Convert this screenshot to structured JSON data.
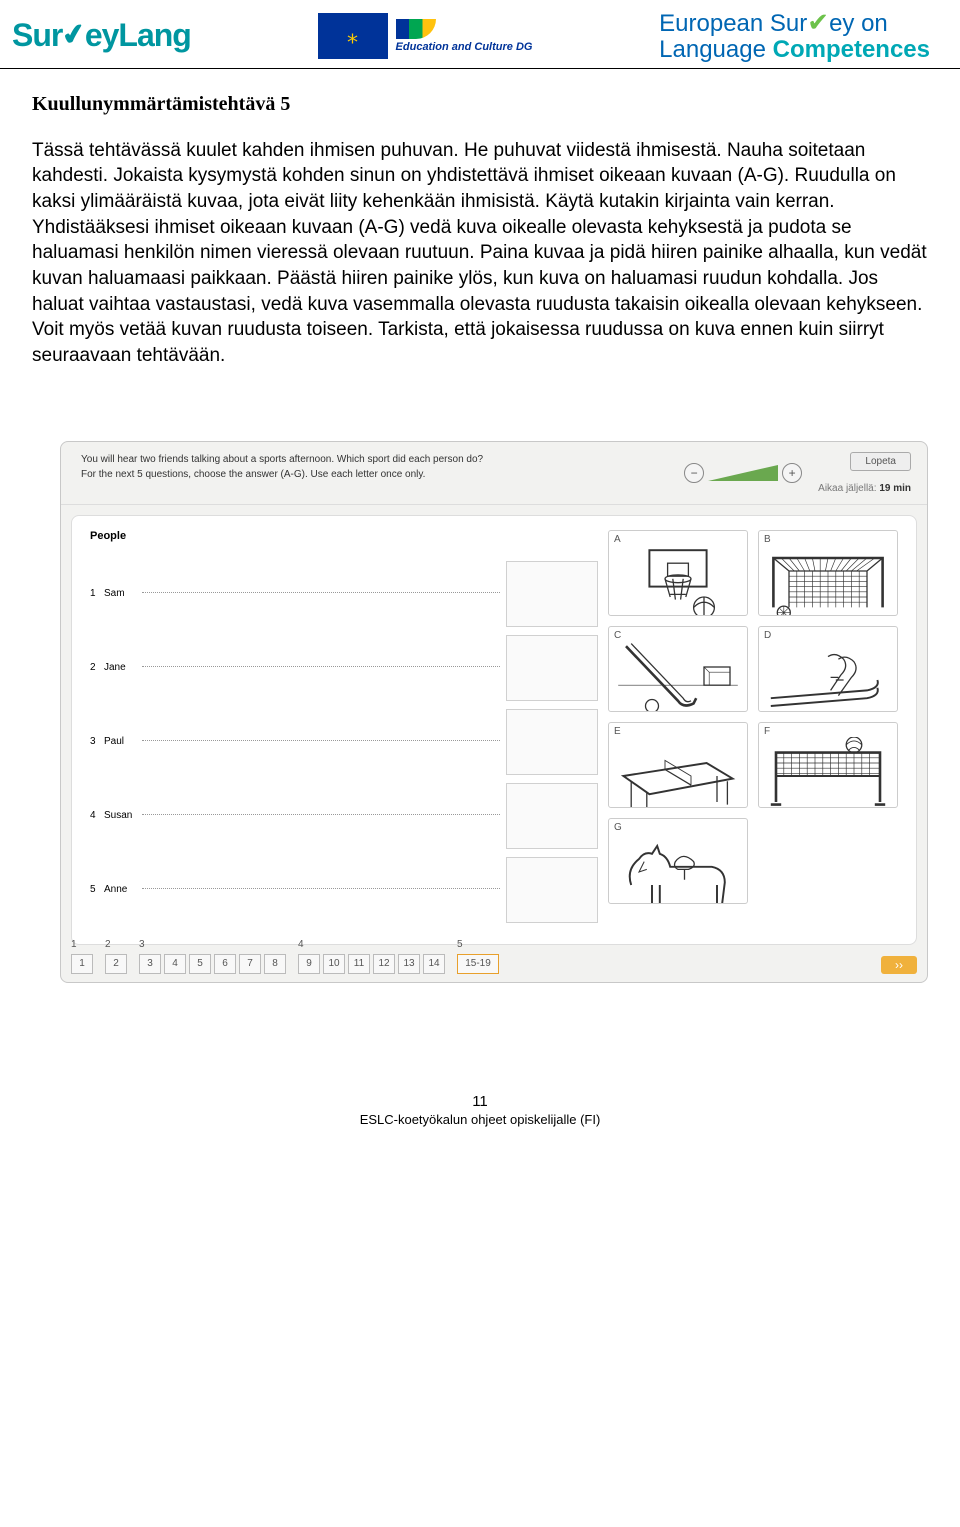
{
  "header": {
    "logo1_part1": "Sur",
    "logo1_part2": "eyLang",
    "logo2_line": "Education and Culture DG",
    "logo3_line1": "European Sur",
    "logo3_line1b": "ey on",
    "logo3_line2a": "Language ",
    "logo3_line2b": "Competences"
  },
  "title": "Kuullunymmärtämistehtävä 5",
  "instructions": "Tässä tehtävässä kuulet kahden ihmisen puhuvan. He puhuvat viidestä ihmisestä. Nauha soitetaan kahdesti. Jokaista kysymystä kohden sinun on yhdistettävä ihmiset oikeaan kuvaan (A-G). Ruudulla on kaksi ylimääräistä kuvaa, jota eivät liity kehenkään ihmisistä. Käytä kutakin kirjainta vain kerran. Yhdistääksesi ihmiset oikeaan kuvaan (A-G) vedä kuva oikealle olevasta kehyksestä ja pudota se haluamasi henkilön nimen vieressä olevaan ruutuun. Paina kuvaa ja pidä hiiren painike alhaalla, kun vedät kuvan haluamaasi paikkaan. Päästä hiiren painike ylös, kun kuva on haluamasi ruudun kohdalla. Jos haluat vaihtaa vastaustasi, vedä kuva vasemmalla olevasta ruudusta takaisin oikealla olevaan kehykseen. Voit myös vetää kuvan ruudusta toiseen. Tarkista, että jokaisessa ruudussa on kuva ennen kuin siirryt seuraavaan tehtävään.",
  "screenshot": {
    "instructions_line1": "You will hear two friends talking about a sports afternoon.  Which sport did each person do?",
    "instructions_line2": "For the next 5 questions, choose the answer (A-G). Use each letter once only.",
    "lopeta": "Lopeta",
    "timer_label": "Aikaa jäljellä:",
    "timer_value": "19 min",
    "people_title": "People",
    "people": [
      {
        "num": "1",
        "name": "Sam"
      },
      {
        "num": "2",
        "name": "Jane"
      },
      {
        "num": "3",
        "name": "Paul"
      },
      {
        "num": "4",
        "name": "Susan"
      },
      {
        "num": "5",
        "name": "Anne"
      }
    ],
    "options": [
      "A",
      "B",
      "C",
      "D",
      "E",
      "F",
      "G"
    ],
    "nav_groups": [
      {
        "label": "1",
        "items": [
          "1"
        ]
      },
      {
        "label": "2",
        "items": [
          "2"
        ]
      },
      {
        "label": "3",
        "items": [
          "3",
          "4",
          "5",
          "6",
          "7",
          "8"
        ]
      },
      {
        "label": "4",
        "items": [
          "9",
          "10",
          "11",
          "12",
          "13",
          "14"
        ]
      },
      {
        "label": "5",
        "items": [
          "15-19"
        ],
        "active": true
      }
    ]
  },
  "footer_page": "11",
  "footer_text": "ESLC-koetyökalun ohjeet opiskelijalle (FI)"
}
